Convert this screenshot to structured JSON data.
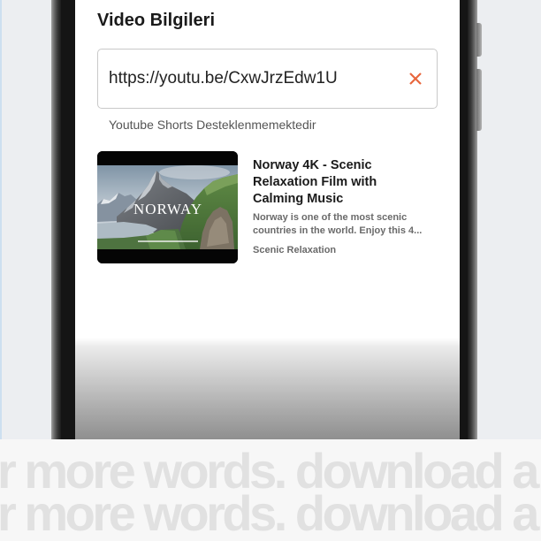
{
  "screen": {
    "heading": "Video Bilgileri",
    "url_field": {
      "value": "https://youtu.be/CxwJrzEdw1U",
      "clear_icon": "close-icon"
    },
    "helper_text": "Youtube Shorts Desteklenmemektedir",
    "video": {
      "thumbnail": {
        "overlay_text": "NORWAY"
      },
      "title": "Norway 4K - Scenic Relaxation Film with Calming Music",
      "description": "Norway is one of the most scenic countries in the world. Enjoy this 4...",
      "channel": "Scenic Relaxation"
    }
  },
  "banner": {
    "lines": [
      "r more words. download a",
      "r more words. download a"
    ]
  },
  "colors": {
    "accent": "#e8663d",
    "text_primary": "#1a1a1a",
    "text_secondary": "#6a6a6a",
    "helper_text": "#555555",
    "field_border": "#c9c9c9",
    "banner_text": "#e1e1e1",
    "banner_bg": "#f7f7f7",
    "page_bg": "#eceef1"
  }
}
